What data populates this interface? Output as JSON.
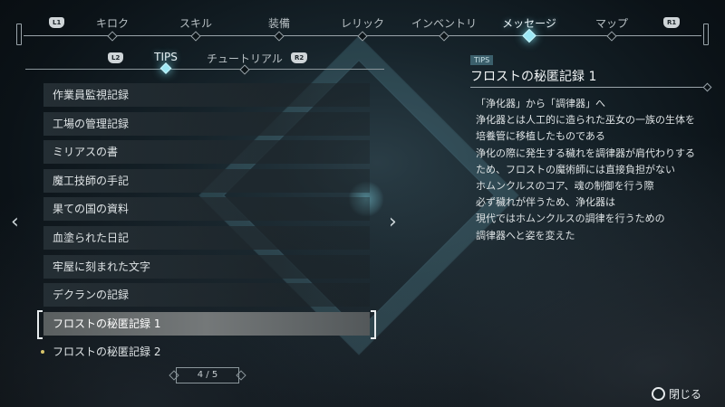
{
  "nav": {
    "left_button": "L1",
    "right_button": "R1",
    "tabs": [
      {
        "label": "キロク",
        "active": false
      },
      {
        "label": "スキル",
        "active": false
      },
      {
        "label": "装備",
        "active": false
      },
      {
        "label": "レリック",
        "active": false
      },
      {
        "label": "インベントリ",
        "active": false
      },
      {
        "label": "メッセージ",
        "active": true
      },
      {
        "label": "マップ",
        "active": false
      }
    ]
  },
  "subnav": {
    "left_button": "L2",
    "right_button": "R2",
    "tabs": [
      {
        "label": "TIPS",
        "active": true
      },
      {
        "label": "チュートリアル",
        "active": false
      }
    ]
  },
  "list": {
    "items": [
      {
        "label": "作業員監視記録"
      },
      {
        "label": "工場の管理記録"
      },
      {
        "label": "ミリアスの書"
      },
      {
        "label": "魔工技師の手記"
      },
      {
        "label": "果ての国の資料"
      },
      {
        "label": "血塗られた日記"
      },
      {
        "label": "牢屋に刻まれた文字"
      },
      {
        "label": "デクランの記録"
      },
      {
        "label": "フロストの秘匿記録 1",
        "selected": true
      },
      {
        "label": "フロストの秘匿記録 2",
        "new": true
      }
    ],
    "page": "4 / 5"
  },
  "detail": {
    "category": "TIPS",
    "title": "フロストの秘匿記録 1",
    "lines": [
      "「浄化器」から「調律器」へ",
      "浄化器とは人工的に造られた巫女の一族の生体を",
      "培養管に移植したものである",
      "浄化の際に発生する穢れを調律器が肩代わりする",
      "ため、フロストの魔術師には直接負担がない",
      "ホムンクルスのコア、魂の制御を行う際",
      "必ず穢れが伴うため、浄化器は",
      "現代ではホムンクルスの調律を行うための",
      "調律器へと姿を変えた"
    ]
  },
  "footer": {
    "close_label": "閉じる"
  },
  "colors": {
    "accent": "#9de8f5",
    "selected_row": "#747879",
    "new_dot": "#d7c46a"
  }
}
